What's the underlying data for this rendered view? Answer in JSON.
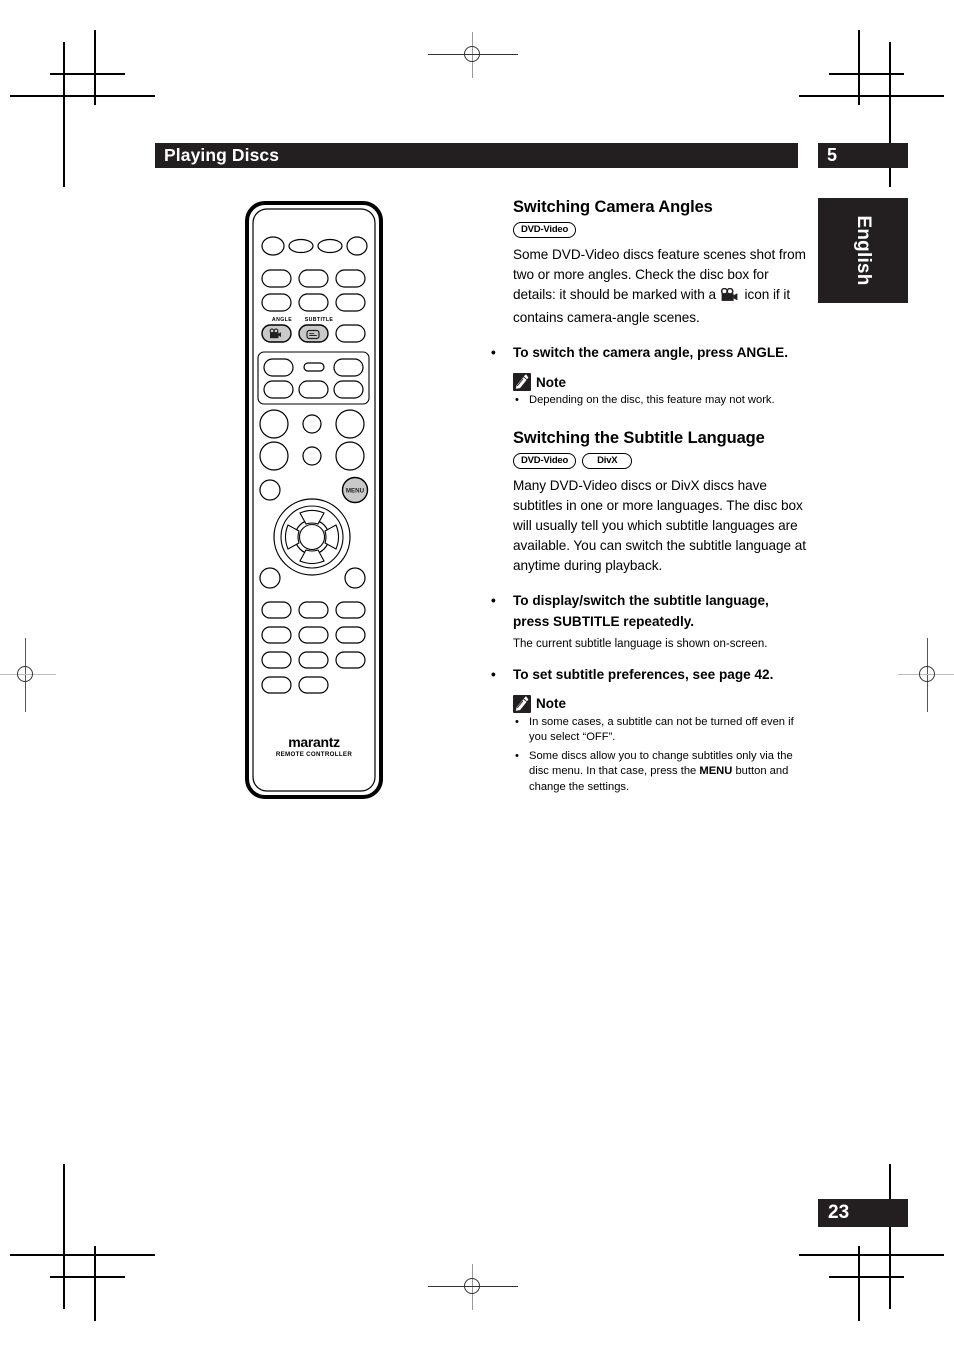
{
  "header": {
    "chapter_title": "Playing Discs",
    "chapter_number": "5"
  },
  "language_tab": "English",
  "page_number": "23",
  "sections": [
    {
      "heading": "Switching Camera Angles",
      "badges": [
        "DVD-Video"
      ],
      "body_part1": "Some DVD-Video discs feature scenes shot from two or more angles. Check the disc box for details: it should be marked with a",
      "body_icon": "movie-camera-icon",
      "body_part2": "icon if it contains camera-angle scenes.",
      "bullet": "•",
      "instruction": "To switch the camera angle, press ANGLE.",
      "note": {
        "label": "Note",
        "icon": "pencil-icon",
        "items": [
          "Depending on the disc, this feature may not work."
        ]
      }
    },
    {
      "heading": "Switching the Subtitle Language",
      "badges": [
        "DVD-Video",
        "DivX"
      ],
      "body": "Many DVD-Video discs or DivX discs have subtitles in one or more languages. The disc box will usually tell you which subtitle languages are available. You can switch the subtitle language at anytime during playback.",
      "instruction1_line1": "To display/switch the subtitle language,",
      "instruction1_line2": "press SUBTITLE repeatedly.",
      "sub_note": "The current subtitle language is shown on-screen.",
      "instruction2": "To set subtitle preferences, see page 42.",
      "note": {
        "label": "Note",
        "icon": "pencil-icon",
        "items": [
          {
            "pre": "In some cases, a subtitle can not be turned off even if you select “OFF”.",
            "bold": "",
            "post": ""
          },
          {
            "pre": "Some discs allow you to change subtitles only via the disc menu. In that case, press the ",
            "bold": "MENU",
            "post": " button and change the settings."
          }
        ]
      }
    }
  ],
  "remote": {
    "brand": "marantz",
    "brand_sub": "REMOTE CONTROLLER",
    "highlighted_buttons": [
      {
        "label": "ANGLE",
        "icon": "camera-icon"
      },
      {
        "label": "SUBTITLE",
        "icon": "subtitle-icon"
      },
      {
        "label": "MENU",
        "icon": "menu-button"
      }
    ]
  },
  "colors": {
    "ink": "#231f20",
    "highlight": "#c9c9c9",
    "paper": "#ffffff"
  }
}
